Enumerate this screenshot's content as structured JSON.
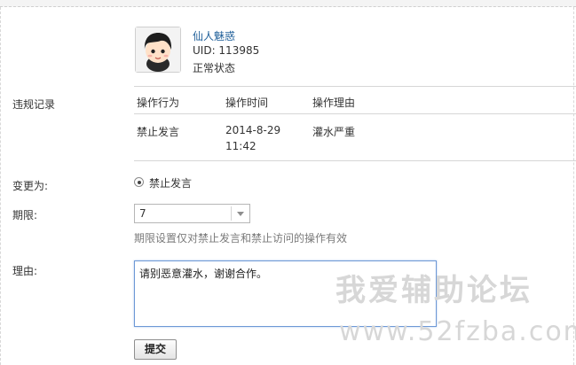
{
  "user": {
    "name": "仙人魅惑",
    "uid": "UID: 113985",
    "status": "正常状态"
  },
  "violations": {
    "label": "违规记录",
    "headers": [
      "操作行为",
      "操作时间",
      "操作理由"
    ],
    "rows": [
      {
        "action": "禁止发言",
        "date": "2014-8-29",
        "time": "11:42",
        "reason": "灌水严重"
      }
    ]
  },
  "form": {
    "change_label": "变更为:",
    "change_option": "禁止发言",
    "period_label": "期限:",
    "period_value": "7",
    "period_hint": "期限设置仅对禁止发言和禁止访问的操作有效",
    "reason_label": "理由:",
    "reason_value": "请别恶意灌水，谢谢合作。",
    "submit_label": "提交"
  },
  "watermark": {
    "title": "我爱辅助论坛",
    "url": "www.52fzba.com"
  }
}
